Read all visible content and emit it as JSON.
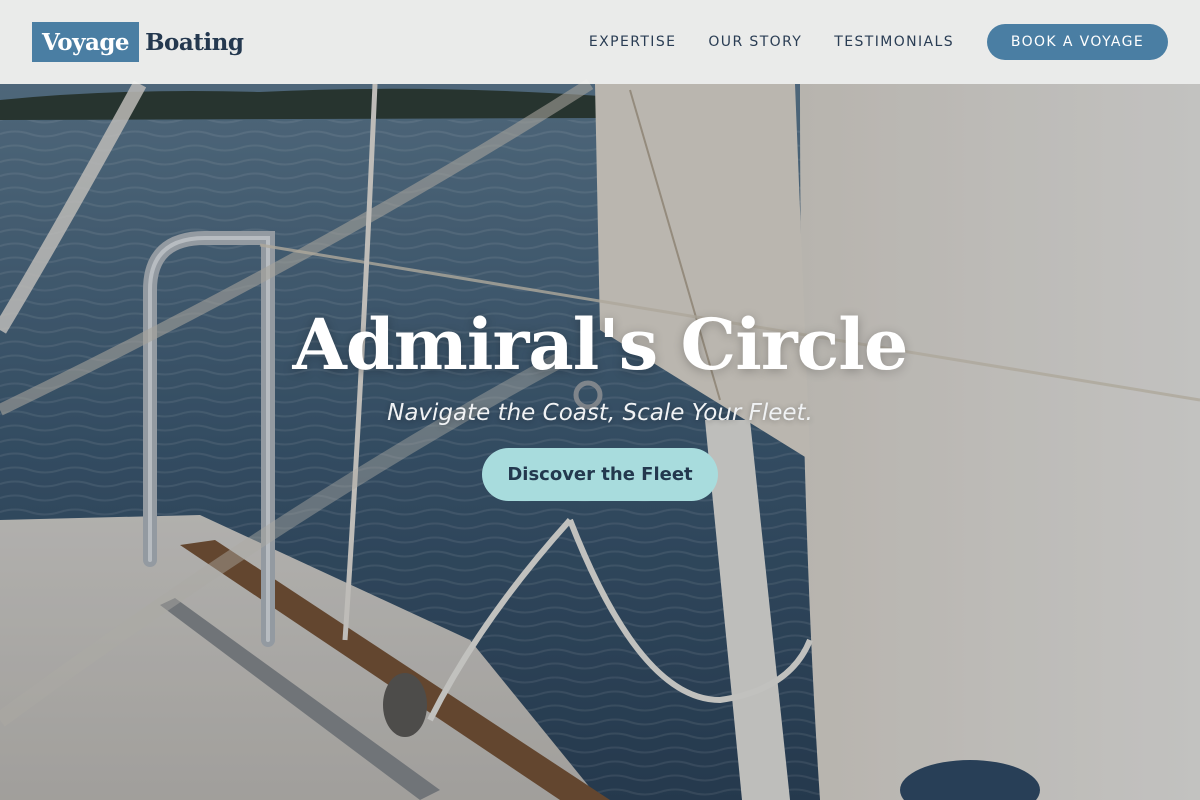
{
  "brand": {
    "logo_box_text": "Voyage",
    "logo_word_text": "Boating"
  },
  "nav": {
    "items": [
      {
        "label": "EXPERTISE"
      },
      {
        "label": "OUR STORY"
      },
      {
        "label": "TESTIMONIALS"
      }
    ],
    "cta_label": "BOOK A VOYAGE"
  },
  "hero": {
    "title": "Admiral's Circle",
    "tagline": "Navigate the Coast, Scale Your Fleet.",
    "cta_label": "Discover the Fleet",
    "background_description_icon": "sailboat-deck-photo"
  },
  "colors": {
    "brand_blue": "#4a7ea3",
    "navy_text": "#24384f",
    "cta_aqua": "#a8dcdd",
    "header_bg": "#f2f2f0"
  }
}
